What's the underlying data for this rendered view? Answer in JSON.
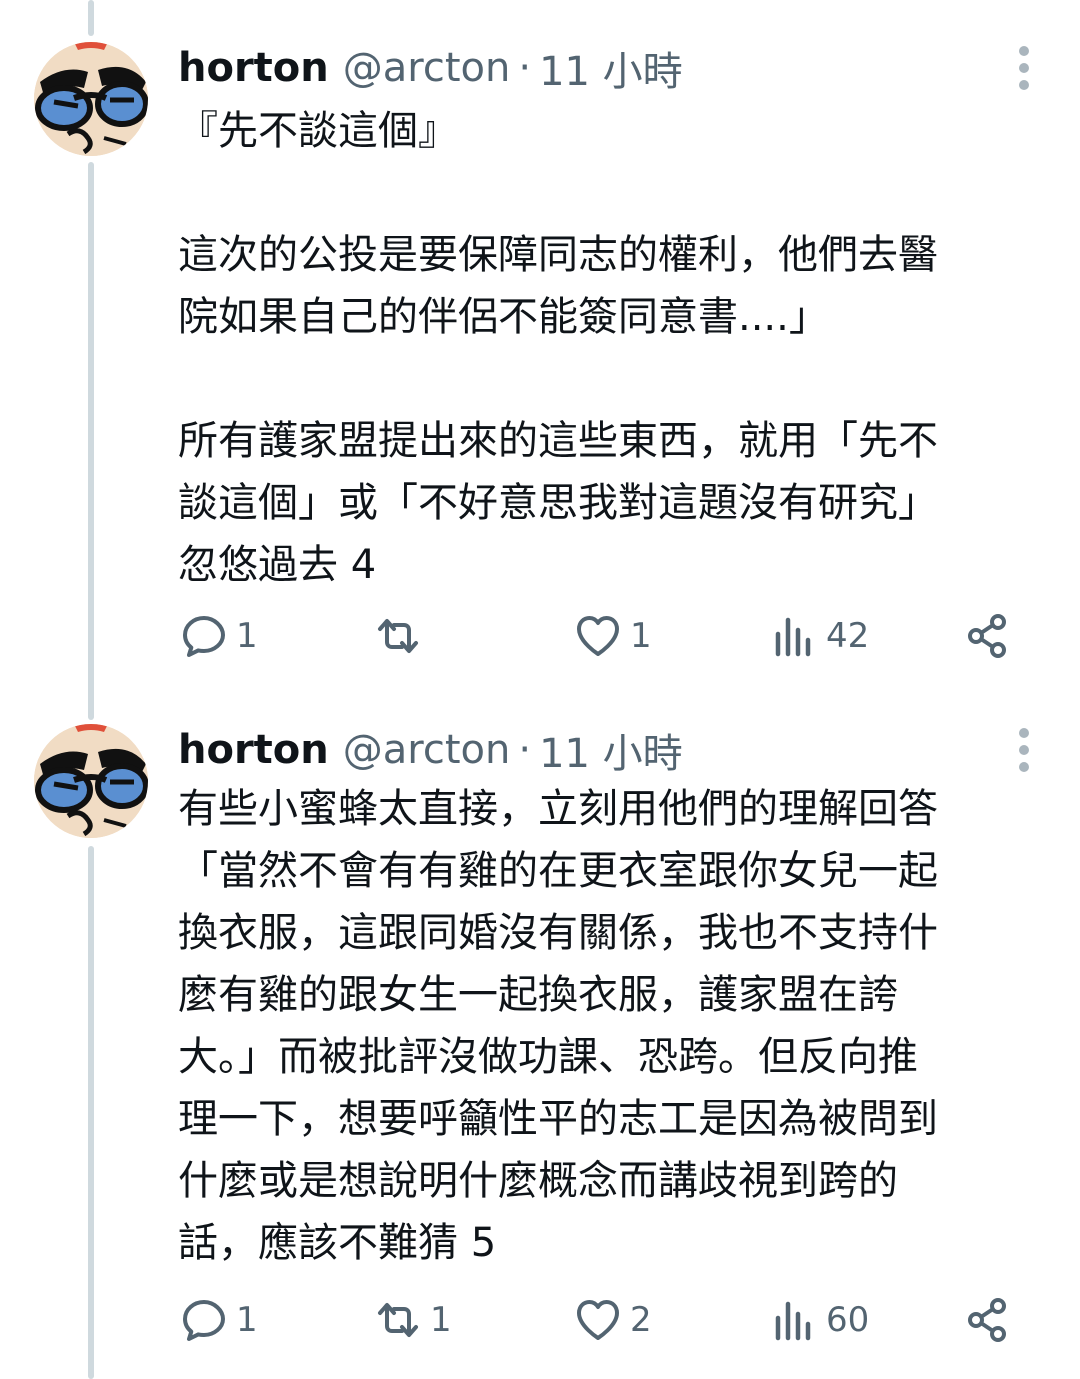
{
  "tweets": [
    {
      "author": {
        "name": "horton",
        "handle": "@arcton"
      },
      "time": "11 小時",
      "lines": [
        "『先不談這個』",
        "",
        "這次的公投是要保障同志的權利，他們去醫",
        "院如果自己的伴侶不能簽同意書....」",
        "",
        "所有護家盟提出來的這些東西，就用「先不",
        "談這個」或「不好意思我對這題沒有研究」",
        "忽悠過去 4"
      ],
      "stats": {
        "replies": "1",
        "reposts": "",
        "likes": "1",
        "views": "42"
      }
    },
    {
      "author": {
        "name": "horton",
        "handle": "@arcton"
      },
      "time": "11 小時",
      "lines": [
        "有些小蜜蜂太直接，立刻用他們的理解回答",
        "「當然不會有有雞的在更衣室跟你女兒一起",
        "換衣服，這跟同婚沒有關係，我也不支持什",
        "麼有雞的跟女生一起換衣服，護家盟在誇",
        "大。」而被批評沒做功課、恐跨。但反向推",
        "理一下，想要呼籲性平的志工是因為被問到",
        "什麼或是想說明什麼概念而講歧視到跨的",
        "話，應該不難猜 5"
      ],
      "stats": {
        "replies": "1",
        "reposts": "1",
        "likes": "2",
        "views": "60"
      }
    }
  ],
  "separator": "·",
  "icons": {
    "avatar": "cartoon-scientist-avatar",
    "more": "more-vertical-icon",
    "reply": "reply-icon",
    "repost": "repost-icon",
    "like": "heart-icon",
    "views": "views-icon",
    "share": "share-icon"
  },
  "colors": {
    "text": "#0f1419",
    "secondary": "#536471",
    "thread_line": "#cfd9de"
  }
}
